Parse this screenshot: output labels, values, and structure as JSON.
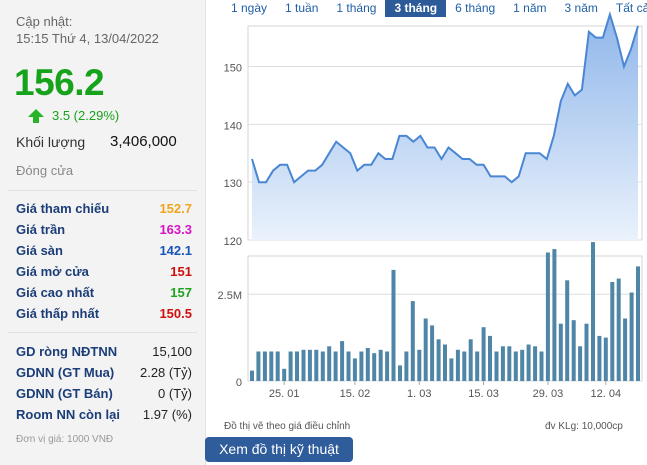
{
  "summary": {
    "update_label": "Cập nhật:",
    "update_time": "15:15 Thứ 4, 13/04/2022",
    "price": "156.2",
    "change": "3.5 (2.29%)",
    "volume_label": "Khối lượng",
    "volume_value": "3,406,000",
    "close_label": "Đóng cửa"
  },
  "prices": [
    {
      "label": "Giá tham chiếu",
      "value": "152.7",
      "color": "#f0a51f"
    },
    {
      "label": "Giá trần",
      "value": "163.3",
      "color": "#d614c5"
    },
    {
      "label": "Giá sàn",
      "value": "142.1",
      "color": "#1a55b8"
    },
    {
      "label": "Giá mở cửa",
      "value": "151",
      "color": "#d10e0e"
    },
    {
      "label": "Giá cao nhất",
      "value": "157",
      "color": "#1ea31e"
    },
    {
      "label": "Giá thấp nhất",
      "value": "150.5",
      "color": "#d10e0e"
    }
  ],
  "foreign": [
    {
      "label": "GD ròng NĐTNN",
      "value": "15,100"
    },
    {
      "label": "GDNN (GT Mua)",
      "value": "2.28 (Tỷ)"
    },
    {
      "label": "GDNN (GT Bán)",
      "value": "0 (Tỷ)"
    },
    {
      "label": "Room NN còn lại",
      "value": "1.97 (%)"
    }
  ],
  "unit_note": "Đơn vị giá: 1000 VNĐ",
  "tabs": [
    {
      "label": "1 ngày",
      "active": false
    },
    {
      "label": "1 tuần",
      "active": false
    },
    {
      "label": "1 tháng",
      "active": false
    },
    {
      "label": "3 tháng",
      "active": true
    },
    {
      "label": "6 tháng",
      "active": false
    },
    {
      "label": "1 năm",
      "active": false
    },
    {
      "label": "3 năm",
      "active": false
    },
    {
      "label": "Tất cả",
      "active": false
    }
  ],
  "colors": {
    "line": "#4a86d4",
    "area_top": "#8fb6ea",
    "area_bottom": "#eaf2fc",
    "bar": "#4f85a6",
    "up": "#17a21b",
    "link": "#1f5fa6"
  },
  "chart_data": {
    "type": "area",
    "price_axis": {
      "min": 120,
      "max": 157,
      "ticks": [
        120,
        130,
        140,
        150
      ]
    },
    "volume_axis": {
      "max": 3600000,
      "ticks": [
        {
          "value": 0,
          "label": "0"
        },
        {
          "value": 2500000,
          "label": "2.5M"
        }
      ]
    },
    "x_labels": [
      {
        "index": 5,
        "label": "25. 01"
      },
      {
        "index": 16,
        "label": "15. 02"
      },
      {
        "index": 26,
        "label": "1. 03"
      },
      {
        "index": 36,
        "label": "15. 03"
      },
      {
        "index": 46,
        "label": "29. 03"
      },
      {
        "index": 55,
        "label": "12. 04"
      }
    ],
    "prices": [
      134,
      130,
      130,
      132,
      133,
      133,
      130,
      131,
      132,
      132,
      133,
      135,
      137,
      136,
      135,
      132,
      133,
      133,
      135,
      134,
      134,
      138,
      138,
      137,
      138,
      136,
      136,
      134,
      136,
      135,
      134,
      134,
      133,
      133,
      131,
      131,
      131,
      130,
      131,
      135,
      135,
      135,
      134,
      138,
      144,
      147,
      145,
      146,
      156,
      155,
      155,
      159,
      155,
      150,
      153,
      157
    ],
    "volumes": [
      300000,
      850000,
      850000,
      850000,
      850000,
      350000,
      850000,
      850000,
      900000,
      900000,
      900000,
      850000,
      1000000,
      850000,
      1150000,
      850000,
      650000,
      850000,
      950000,
      800000,
      900000,
      850000,
      3200000,
      450000,
      850000,
      2300000,
      900000,
      1800000,
      1600000,
      1200000,
      1050000,
      650000,
      900000,
      850000,
      1200000,
      850000,
      1550000,
      1300000,
      850000,
      1000000,
      1000000,
      850000,
      900000,
      1050000,
      1000000,
      850000,
      3700000,
      3800000,
      1650000,
      2900000,
      1750000,
      1000000,
      1650000,
      4000000,
      1300000,
      1250000,
      2850000,
      2950000,
      1800000,
      2550000,
      3300000
    ]
  },
  "notes": {
    "left": "Đồ thị vẽ theo giá điều chỉnh",
    "right": "đv KLg: 10,000cp"
  },
  "technical_button": "Xem đồ thị kỹ thuật"
}
